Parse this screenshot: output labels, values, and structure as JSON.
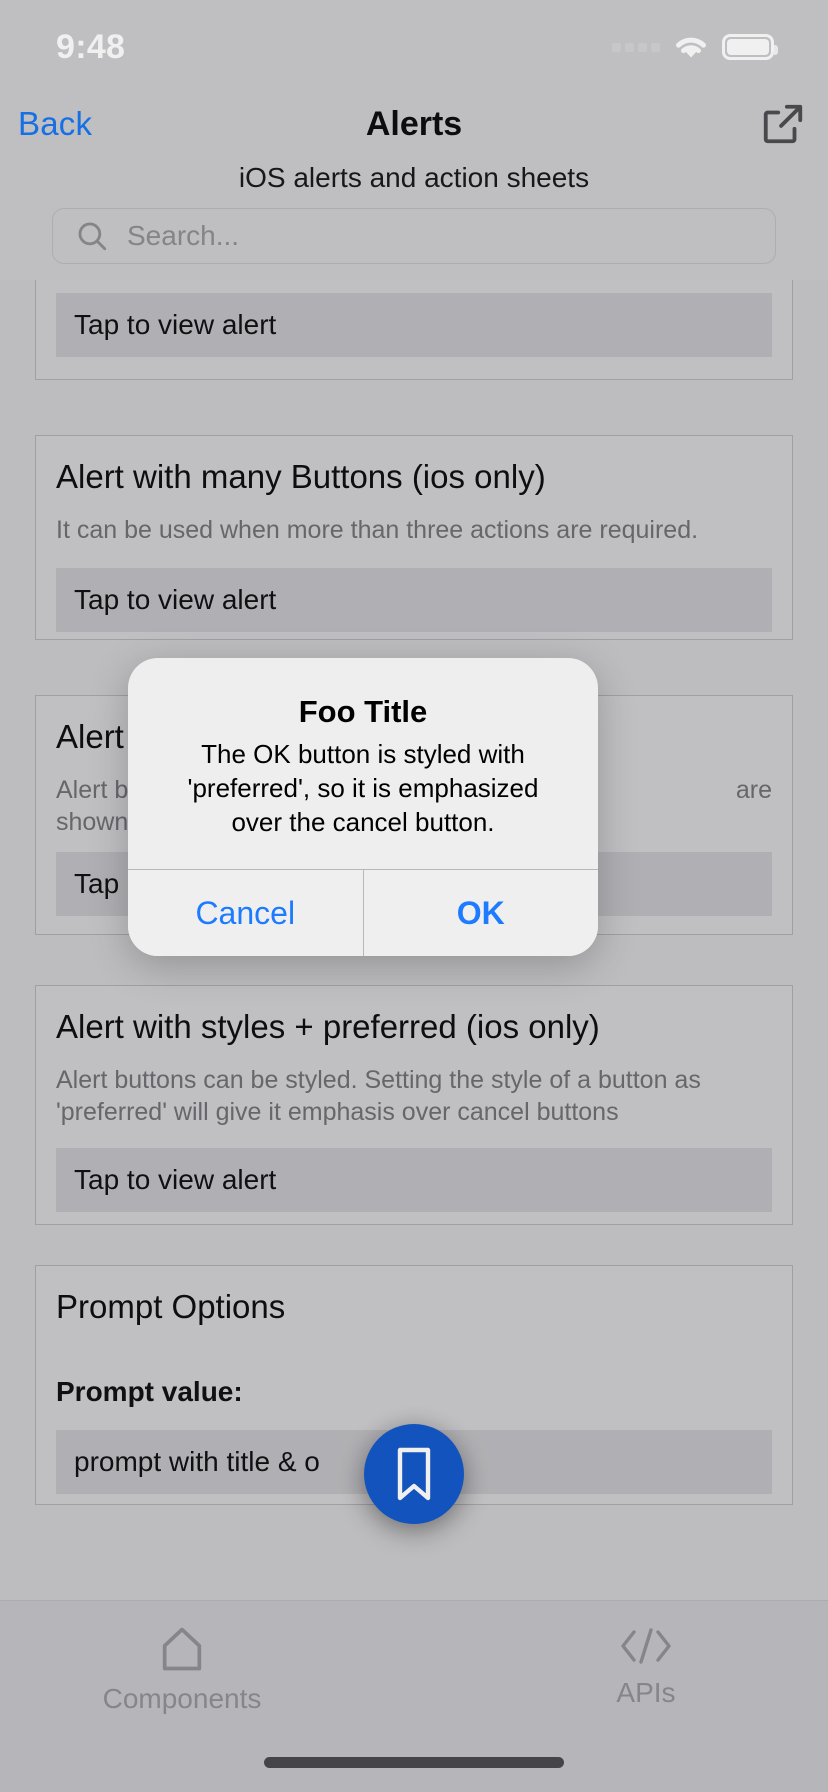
{
  "status_bar": {
    "time": "9:48",
    "icons": [
      "signal-dots-icon",
      "wifi-icon",
      "battery-icon"
    ]
  },
  "nav": {
    "back_label": "Back",
    "title": "Alerts",
    "share_icon": "external-link-icon"
  },
  "header": {
    "subtitle": "iOS alerts and action sheets"
  },
  "search": {
    "placeholder": "Search...",
    "value": "",
    "icon": "search-icon"
  },
  "cards": [
    {
      "title": "",
      "desc": "",
      "button_label": "Tap to view alert"
    },
    {
      "title": "Alert with many Buttons (ios only)",
      "desc": "It can be used when more than three actions are required.",
      "button_label": "Tap to view alert"
    },
    {
      "title": "Alert",
      "desc_left": "Alert bu",
      "desc_left2": "shown",
      "desc_right": "are",
      "button_label": "Tap"
    },
    {
      "title": "Alert with styles + preferred (ios only)",
      "desc": "Alert buttons can be styled. Setting the style of a button as 'preferred' will give it emphasis over cancel buttons",
      "button_label": "Tap to view alert"
    },
    {
      "title": "Prompt Options",
      "field_label": "Prompt value:",
      "field_value": "prompt with title & o"
    }
  ],
  "alert_dialog": {
    "title": "Foo Title",
    "message": "The OK button is styled with 'preferred', so it is emphasized over the cancel button.",
    "cancel_label": "Cancel",
    "ok_label": "OK",
    "accent_color": "#1d7bff"
  },
  "tabbar": {
    "items": [
      {
        "label": "Components",
        "icon": "home-icon"
      },
      {
        "label": "APIs",
        "icon": "code-brackets-icon"
      }
    ],
    "fab": {
      "icon": "bookmark-icon",
      "color": "#1559c9"
    }
  }
}
